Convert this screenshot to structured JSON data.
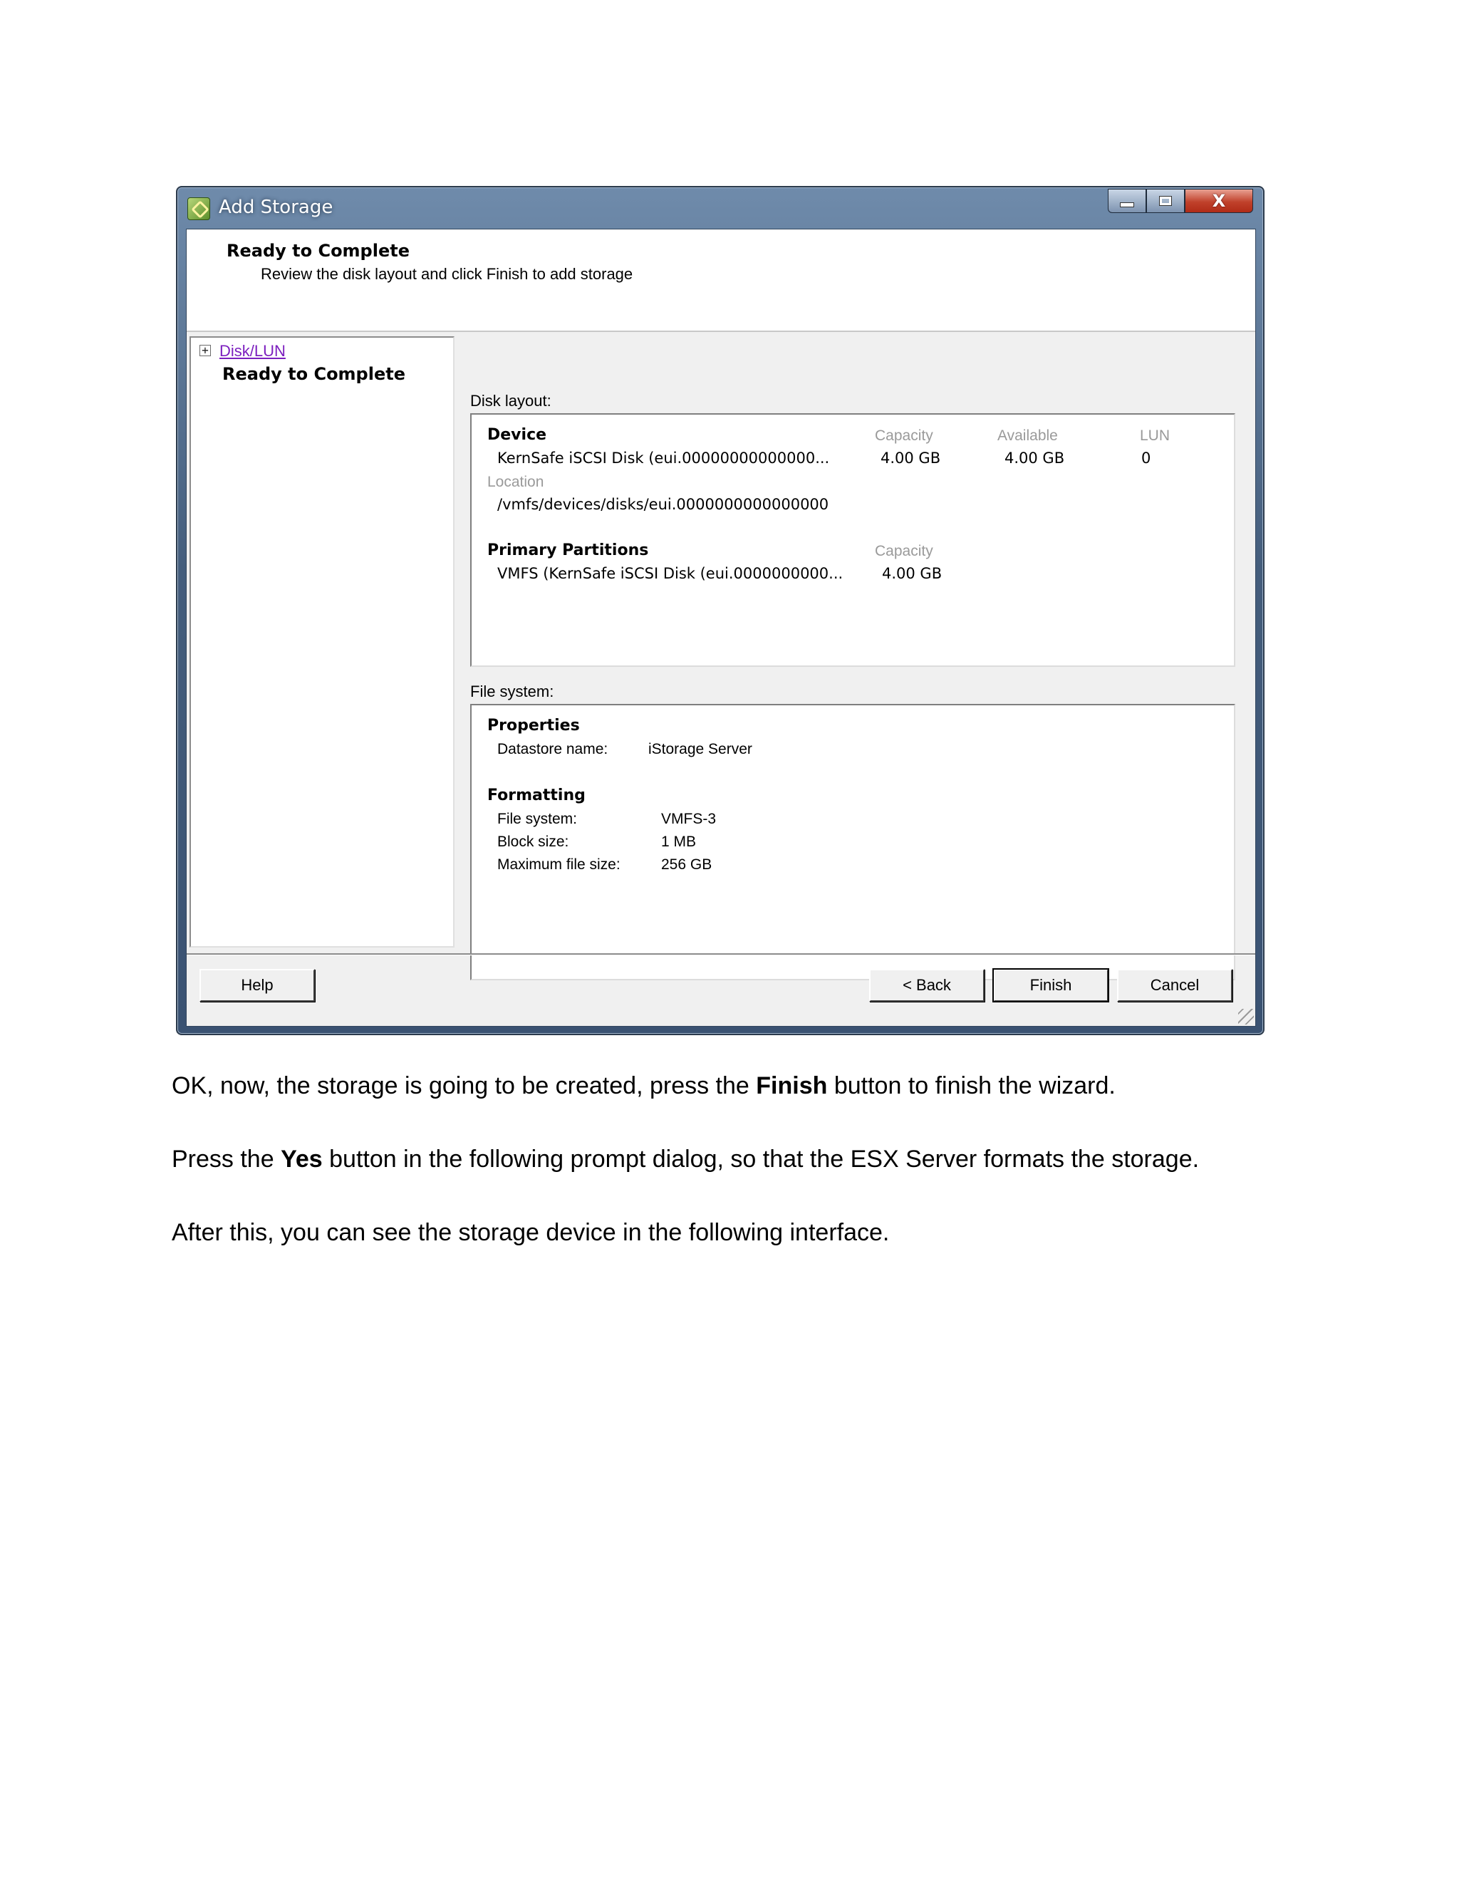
{
  "window": {
    "title": "Add Storage",
    "controls": {
      "minimize": "minimize",
      "maximize": "maximize",
      "close": "X"
    }
  },
  "header": {
    "title": "Ready to Complete",
    "subtitle": "Review the disk layout and click Finish to add storage"
  },
  "nav": {
    "expander": "+",
    "link": "Disk/LUN",
    "current": "Ready to Complete"
  },
  "disk_layout": {
    "label": "Disk layout:",
    "device_heading": "Device",
    "capacity_heading": "Capacity",
    "available_heading": "Available",
    "lun_heading": "LUN",
    "device_name": "KernSafe iSCSI Disk (eui.00000000000000...",
    "capacity": "4.00 GB",
    "available": "4.00 GB",
    "lun": "0",
    "location_heading": "Location",
    "location": "/vmfs/devices/disks/eui.0000000000000000",
    "partitions_heading": "Primary Partitions",
    "partition_capacity_heading": "Capacity",
    "partition_name": "VMFS (KernSafe iSCSI Disk (eui.0000000000...",
    "partition_capacity": "4.00 GB"
  },
  "file_system": {
    "label": "File system:",
    "properties_heading": "Properties",
    "datastore_label": "Datastore name:",
    "datastore_value": "iStorage Server",
    "formatting_heading": "Formatting",
    "fs_label": "File system:",
    "fs_value": "VMFS-3",
    "block_label": "Block size:",
    "block_value": "1 MB",
    "max_label": "Maximum file size:",
    "max_value": "256 GB"
  },
  "buttons": {
    "help": "Help",
    "back": "< Back",
    "finish": "Finish",
    "cancel": "Cancel"
  },
  "body_text": {
    "p1_before": "OK, now, the storage is going to be created, press the ",
    "p1_bold": "Finish",
    "p1_after": " button to finish the wizard.",
    "p2_before": "Press the ",
    "p2_bold": "Yes",
    "p2_after": " button in the following prompt dialog, so that the ESX Server formats the storage.",
    "p3": "After this, you can see the storage device in the following interface."
  }
}
